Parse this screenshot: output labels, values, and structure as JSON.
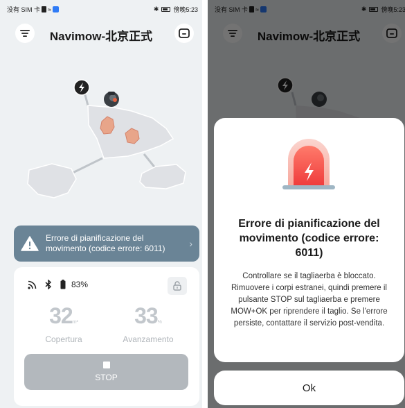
{
  "status_bar": {
    "carrier": "没有 SIM 卡",
    "time": "傍晚5:23"
  },
  "header": {
    "title": "Navimow-北京正式"
  },
  "error_banner": {
    "message": "Errore di pianificazione del movimento (codice errore: 6011)"
  },
  "status_panel": {
    "battery_percent": "83%",
    "coverage_value": "32",
    "coverage_unit": "m²",
    "coverage_label": "Copertura",
    "progress_value": "33",
    "progress_unit": "%",
    "progress_label": "Avanzamento",
    "stop_label": "STOP"
  },
  "dialog": {
    "title": "Errore di pianificazione del movimento (codice errore: 6011)",
    "body": "Controllare se il tagliaerba è bloccato. Rimuovere i corpi estranei, quindi premere il pulsante STOP sul tagliaerba e premere MOW+OK per riprendere il taglio. Se l'errore persiste, contattare il servizio post-vendita.",
    "ok_label": "Ok"
  },
  "colors": {
    "banner_bg": "#6a8496",
    "stop_button_bg": "#b3b8bd",
    "alarm_red": "#f04a4a",
    "map_zone": "#dfe1e5",
    "obstacle": "#e8a58a"
  },
  "icons": [
    "menu-icon",
    "screen-icon",
    "charging-station-icon",
    "mower-icon",
    "warning-icon",
    "chevron-right-icon",
    "signal-icon",
    "bluetooth-icon",
    "battery-icon",
    "unlock-icon",
    "stop-icon",
    "alarm-light-icon"
  ]
}
